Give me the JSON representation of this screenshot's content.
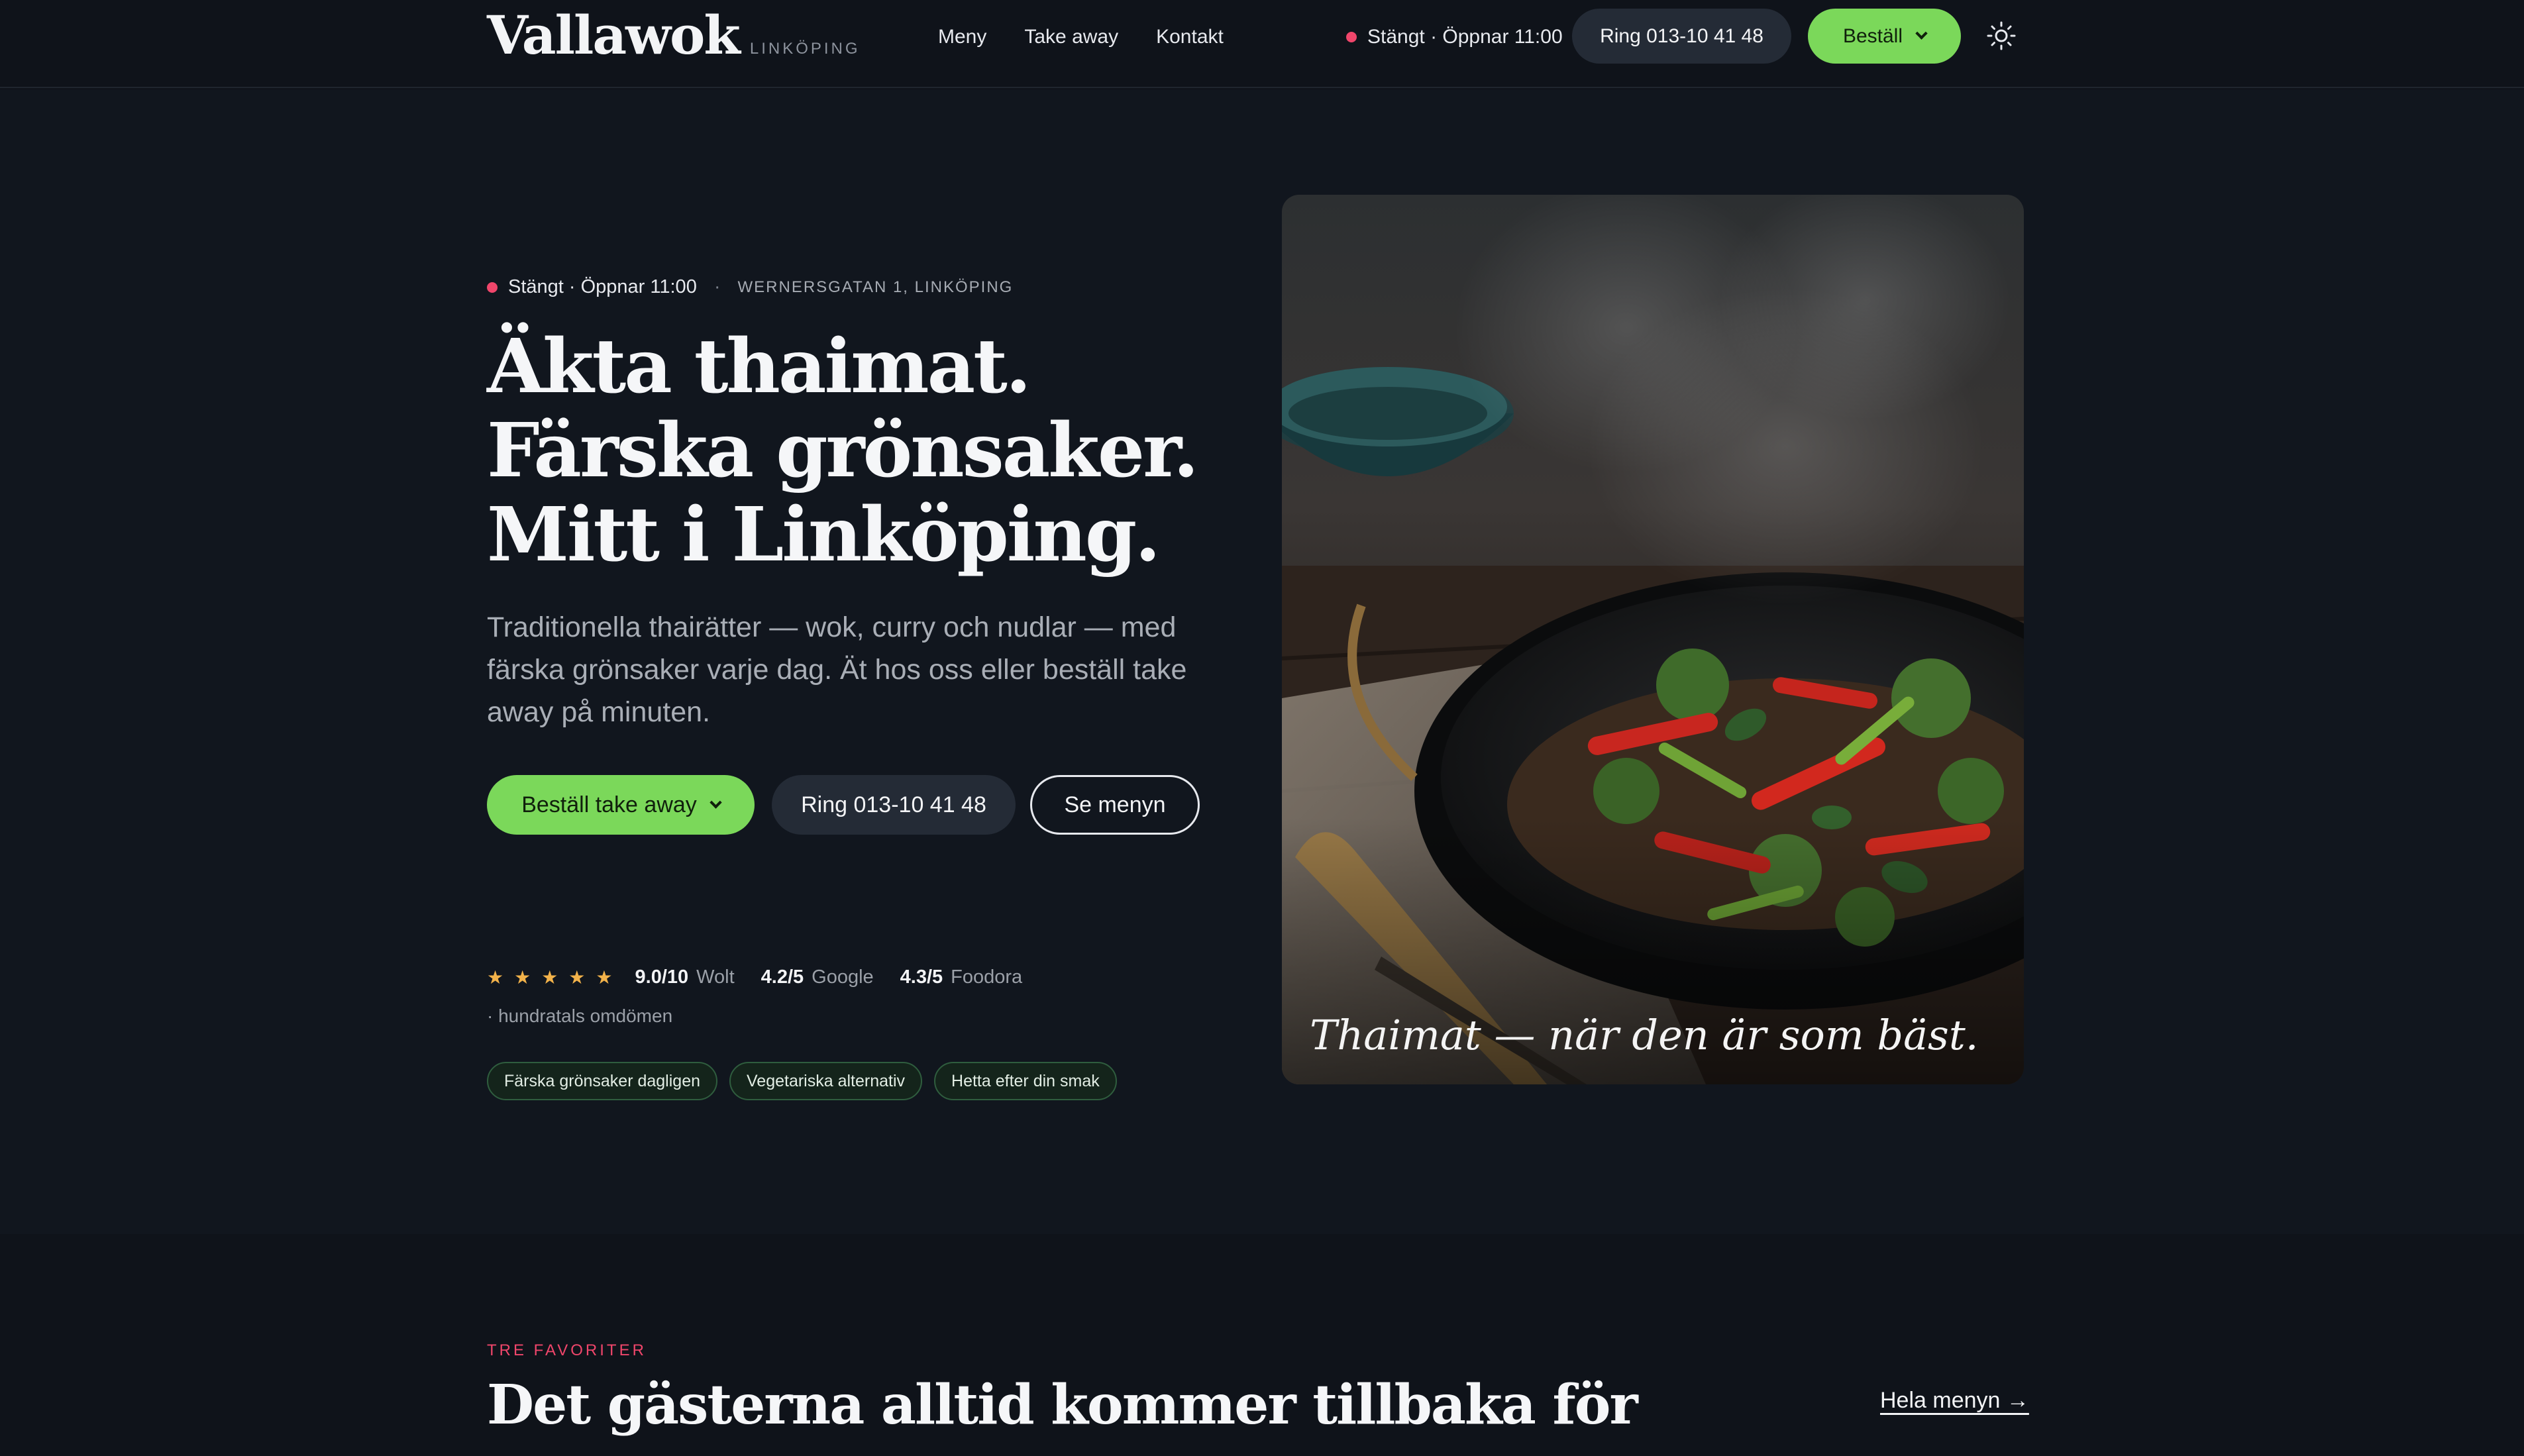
{
  "header": {
    "brand_name": "Vallawok",
    "brand_city": "LINKÖPING",
    "nav": [
      "Meny",
      "Take away",
      "Kontakt"
    ],
    "status": "Stängt · Öppnar 11:00",
    "call_label": "Ring 013-10 41 48",
    "order_label": "Beställ"
  },
  "hero": {
    "status": "Stängt · Öppnar 11:00",
    "address": "WERNERSGATAN 1, LINKÖPING",
    "title_lines": [
      "Äkta thaimat.",
      "Färska grönsaker.",
      "Mitt i Linköping."
    ],
    "lead": "Traditionella thairätter — wok, curry och nudlar — med färska grönsaker varje dag. Ät hos oss eller beställ take away på minuten.",
    "cta_primary": "Beställ take away",
    "cta_call": "Ring 013-10 41 48",
    "cta_menu": "Se menyn",
    "ratings": [
      {
        "score": "9.0/10",
        "source": "Wolt"
      },
      {
        "score": "4.2/5",
        "source": "Google"
      },
      {
        "score": "4.3/5",
        "source": "Foodora"
      }
    ],
    "reviews_note": "· hundratals omdömen",
    "chips": [
      "Färska grönsaker dagligen",
      "Vegetariska alternativ",
      "Hetta efter din smak"
    ],
    "image_caption": "Thaimat — när den är som bäst."
  },
  "favorites": {
    "eyebrow": "TRE FAVORITER",
    "title": "Det gästerna alltid kommer tillbaka för",
    "link": "Hela menyn →"
  },
  "colors": {
    "accent_green": "#7bd85a",
    "status_red": "#f0466b",
    "star": "#f2b24a",
    "background": "#0f131a"
  },
  "icons": [
    "chevron-down-icon",
    "sun-icon",
    "star-icon",
    "status-dot-icon"
  ]
}
